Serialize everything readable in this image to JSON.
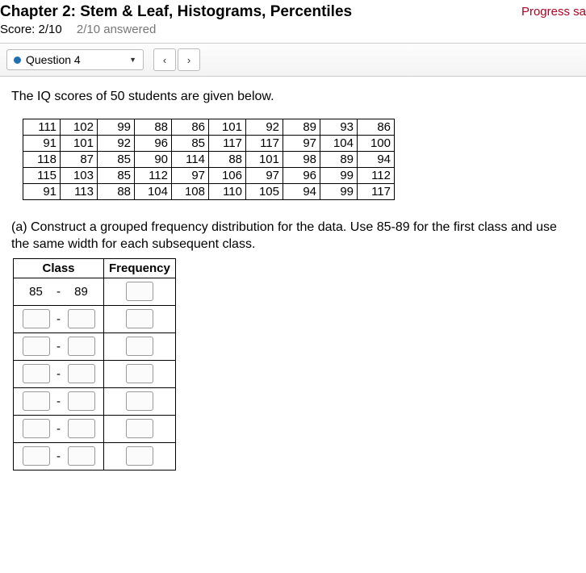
{
  "header": {
    "title": "Chapter 2: Stem & Leaf, Histograms, Percentiles",
    "progress": "Progress sa",
    "score_label": "Score: 2/10",
    "answered_label": "2/10 answered"
  },
  "toolbar": {
    "question_label": "Question 4",
    "prev": "‹",
    "next": "›"
  },
  "intro": "The IQ scores of 50 students are given below.",
  "data_rows": [
    [
      "111",
      "102",
      "99",
      "88",
      "86",
      "101",
      "92",
      "89",
      "93",
      "86"
    ],
    [
      "91",
      "101",
      "92",
      "96",
      "85",
      "117",
      "117",
      "97",
      "104",
      "100"
    ],
    [
      "118",
      "87",
      "85",
      "90",
      "114",
      "88",
      "101",
      "98",
      "89",
      "94"
    ],
    [
      "115",
      "103",
      "85",
      "112",
      "97",
      "106",
      "97",
      "96",
      "99",
      "112"
    ],
    [
      "91",
      "113",
      "88",
      "104",
      "108",
      "110",
      "105",
      "94",
      "99",
      "117"
    ]
  ],
  "part_a": "(a) Construct a grouped frequency distribution for the data. Use 85-89 for the first class and use the same width for each subsequent class.",
  "freq_table": {
    "header_class": "Class",
    "header_freq": "Frequency",
    "first_low": "85",
    "dash": "-",
    "first_high": "89",
    "blank_rows": 6
  }
}
